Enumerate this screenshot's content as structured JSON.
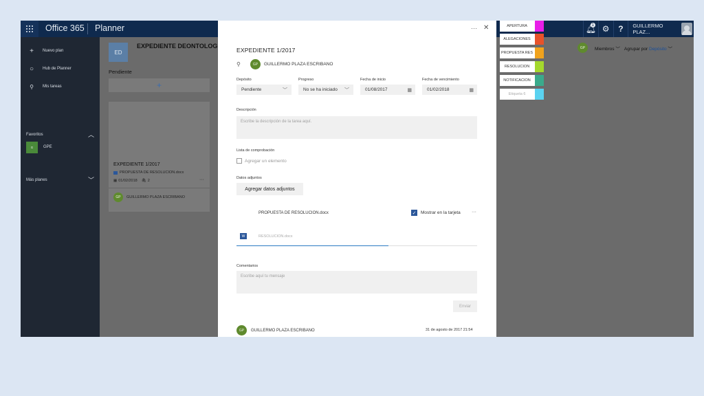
{
  "topbar": {
    "brand": "Office 365",
    "app_name": "Planner",
    "notification_count": "1",
    "user_name": "GUILLERMO PLAZ..."
  },
  "leftnav": {
    "new_plan": "Nuevo plan",
    "hub": "Hub de Planner",
    "my_tasks": "Mis tareas",
    "favorites": "Favoritos",
    "fav_tile": "G",
    "fav_plan": "GPE",
    "more_plans": "Más planes"
  },
  "board": {
    "plan_initials": "ED",
    "plan_title": "EXPEDIENTE DEONTOLOGICO",
    "bucket": "Pendiente",
    "add_symbol": "+",
    "card": {
      "title": "EXPEDIENTE 1/2017",
      "attachment": "PROPUESTA DE RESOLUCION.docx",
      "due": "01/02/2018",
      "attach_count": "2",
      "user_initials": "GP",
      "user": "GUILLERMO PLAZA ESCRIBANO"
    },
    "members_initials": "GP",
    "members": "Miembros",
    "group_by_label": "Agrupar por",
    "group_by_value": "Depósito"
  },
  "modal": {
    "more": "···",
    "close": "✕",
    "title": "EXPEDIENTE 1/2017",
    "assignee_initials": "GP",
    "assignee": "GUILLERMO PLAZA ESCRIBANO",
    "bucket_label": "Depósito",
    "bucket_value": "Pendiente",
    "progress_label": "Progreso",
    "progress_value": "No se ha iniciado",
    "start_label": "Fecha de inicio",
    "start_value": "01/08/2017",
    "due_label": "Fecha de vencimiento",
    "due_value": "01/02/2018",
    "description_label": "Descripción",
    "description_placeholder": "Escribe la descripción de la tarea aquí.",
    "checklist_label": "Lista de comprobación",
    "checklist_add": "Agregar un elemento",
    "attachments_label": "Datos adjuntos",
    "attachments_button": "Agregar datos adjuntos",
    "attachment_name": "PROPUESTA DE RESOLUCION.docx",
    "show_on_card": "Mostrar en la tarjeta",
    "attachment_more": "···",
    "upload_name": "RESOLUCION.docx",
    "comments_label": "Comentarios",
    "comments_placeholder": "Escribe aquí tu mensaje",
    "send_button": "Enviar",
    "comment_initials": "GP",
    "comment_user": "GUILLERMO PLAZA ESCRIBANO",
    "comment_date": "31 de agosto de 2017 21:54"
  },
  "labels": [
    {
      "name": "APERTURA",
      "color": "#e81ee8"
    },
    {
      "name": "ALEGACIONES",
      "color": "#e8522a"
    },
    {
      "name": "PROPUESTA RES",
      "color": "#f0a21c"
    },
    {
      "name": "RESOLUCION",
      "color": "#a4d82c"
    },
    {
      "name": "NOTIFICACION",
      "color": "#3aaa8c"
    },
    {
      "name": "Etiqueta 6",
      "color": "#5ad2f0"
    }
  ]
}
